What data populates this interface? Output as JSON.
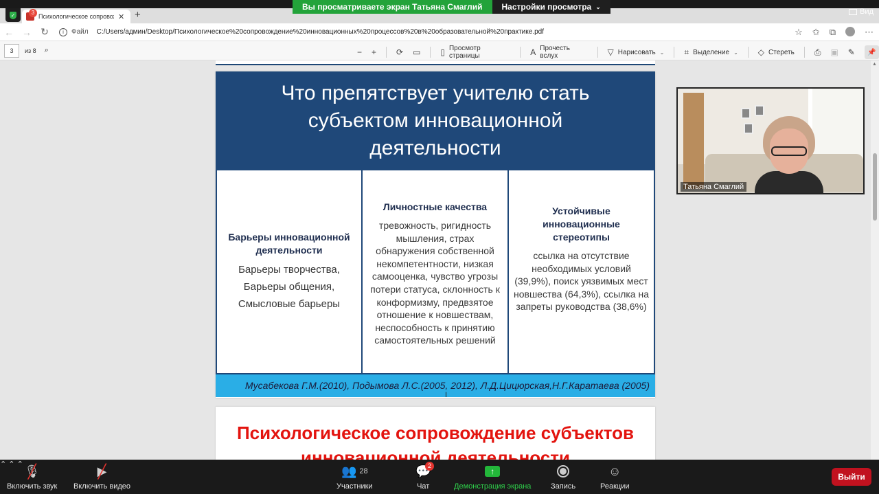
{
  "zoom": {
    "banner_viewing": "Вы просматриваете экран Татьяна Смаглий",
    "banner_settings": "Настройки просмотра",
    "view_label": "Вид",
    "toolbar": {
      "mute": "Включить звук",
      "video": "Включить видео",
      "participants": "Участники",
      "participants_count": "28",
      "chat": "Чат",
      "chat_badge": "2",
      "share": "Демонстрация экрана",
      "record": "Запись",
      "reactions": "Реакции",
      "leave": "Выйти"
    },
    "video_name": "Татьяна Смаглий"
  },
  "browser": {
    "tab_title": "Психологическое сопровожде",
    "tab_badge": "3",
    "file_label": "Файл",
    "url": "C:/Users/админ/Desktop/Психологическое%20сопровождение%20инновационных%20процессов%20в%20образовательной%20практике.pdf"
  },
  "pdf_toolbar": {
    "page_current": "3",
    "page_of": "из 8",
    "page_view": "Просмотр страницы",
    "read_aloud": "Прочесть вслух",
    "draw": "Нарисовать",
    "highlight": "Выделение",
    "erase": "Стереть"
  },
  "slide": {
    "title": "Что препятствует учителю стать субъектом инновационной деятельности",
    "col1_head": "Барьеры инновационной деятельности",
    "col1_items": [
      "Барьеры творчества,",
      "Барьеры общения,",
      "Смысловые барьеры"
    ],
    "col2_head": "Личностные качества",
    "col2_text": "тревожность, ригидность мышления, страх обнаружения собственной некомпетентности, низкая самооценка, чувство угрозы потери статуса, склонность к конформизму, предвзятое отношение к новшествам, неспособность к принятию самостоятельных решений",
    "col3_head": "Устойчивые инновационные стереотипы",
    "col3_text": "ссылка на отсутствие необходимых условий (39,9%), поиск уязвимых мест новшества (64,3%), ссылка на запреты руководства (38,6%)",
    "citation": "Мусабекова Г.М.(2010), Подымова Л.С.(2005, 2012), Л.Д.Цицюрская,Н.Г.Каратаева (2005)"
  },
  "slide2": {
    "title": "Психологическое сопровождение субъектов инновационной деятельности"
  }
}
